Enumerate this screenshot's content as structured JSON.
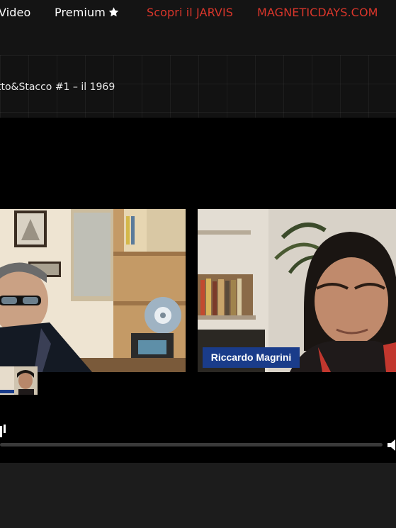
{
  "nav": {
    "items": [
      {
        "label": "Video"
      },
      {
        "label": "Premium"
      },
      {
        "label": "Scopri il JARVIS"
      },
      {
        "label": "MAGNETICDAYS.COM"
      }
    ],
    "premium_icon": "star-icon",
    "colors": {
      "link_white": "#ffffff",
      "link_red": "#d9362b"
    }
  },
  "page": {
    "title": "tto&Stacco #1 – il 1969"
  },
  "video": {
    "name_tag": "Riccardo Magrini",
    "progress_fraction": 0.0,
    "controls": {
      "play_icon": "play-icon",
      "volume_icon": "volume-icon"
    },
    "colors": {
      "name_tag_bg": "#1a3c8a",
      "player_bg": "#000000"
    }
  }
}
